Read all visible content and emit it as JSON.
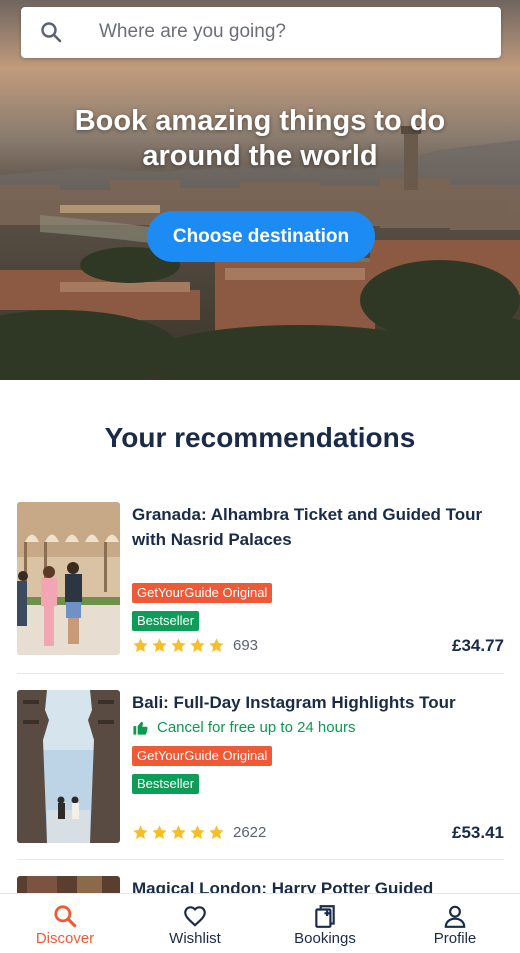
{
  "search": {
    "placeholder": "Where are you going?",
    "icon": "search-icon"
  },
  "hero": {
    "title": "Book amazing things to do around the world",
    "button_label": "Choose destination"
  },
  "recommendations": {
    "heading": "Your recommendations",
    "items": [
      {
        "title": "Granada: Alhambra Ticket and Guided Tour with Nasrid Palaces",
        "cancel_text": "",
        "badge_original": "GetYourGuide Original",
        "badge_bestseller": "Bestseller",
        "rating_stars": 5,
        "review_count": "693",
        "price": "£34.77"
      },
      {
        "title": "Bali: Full-Day Instagram Highlights Tour",
        "cancel_text": "Cancel for free up to 24 hours",
        "badge_original": "GetYourGuide Original",
        "badge_bestseller": "Bestseller",
        "rating_stars": 5,
        "review_count": "2622",
        "price": "£53.41"
      },
      {
        "title": "Magical London: Harry Potter Guided Walking"
      }
    ]
  },
  "nav": {
    "items": [
      {
        "label": "Discover",
        "icon": "search-icon",
        "active": true
      },
      {
        "label": "Wishlist",
        "icon": "heart-icon",
        "active": false
      },
      {
        "label": "Bookings",
        "icon": "bookings-icon",
        "active": false
      },
      {
        "label": "Profile",
        "icon": "person-icon",
        "active": false
      }
    ]
  },
  "colors": {
    "accent": "#ee5a36",
    "primary_button": "#1c8bf3",
    "success": "#0a9a50",
    "bestseller": "#0d9d58",
    "text": "#1a2b49",
    "star": "#f6bf26"
  }
}
